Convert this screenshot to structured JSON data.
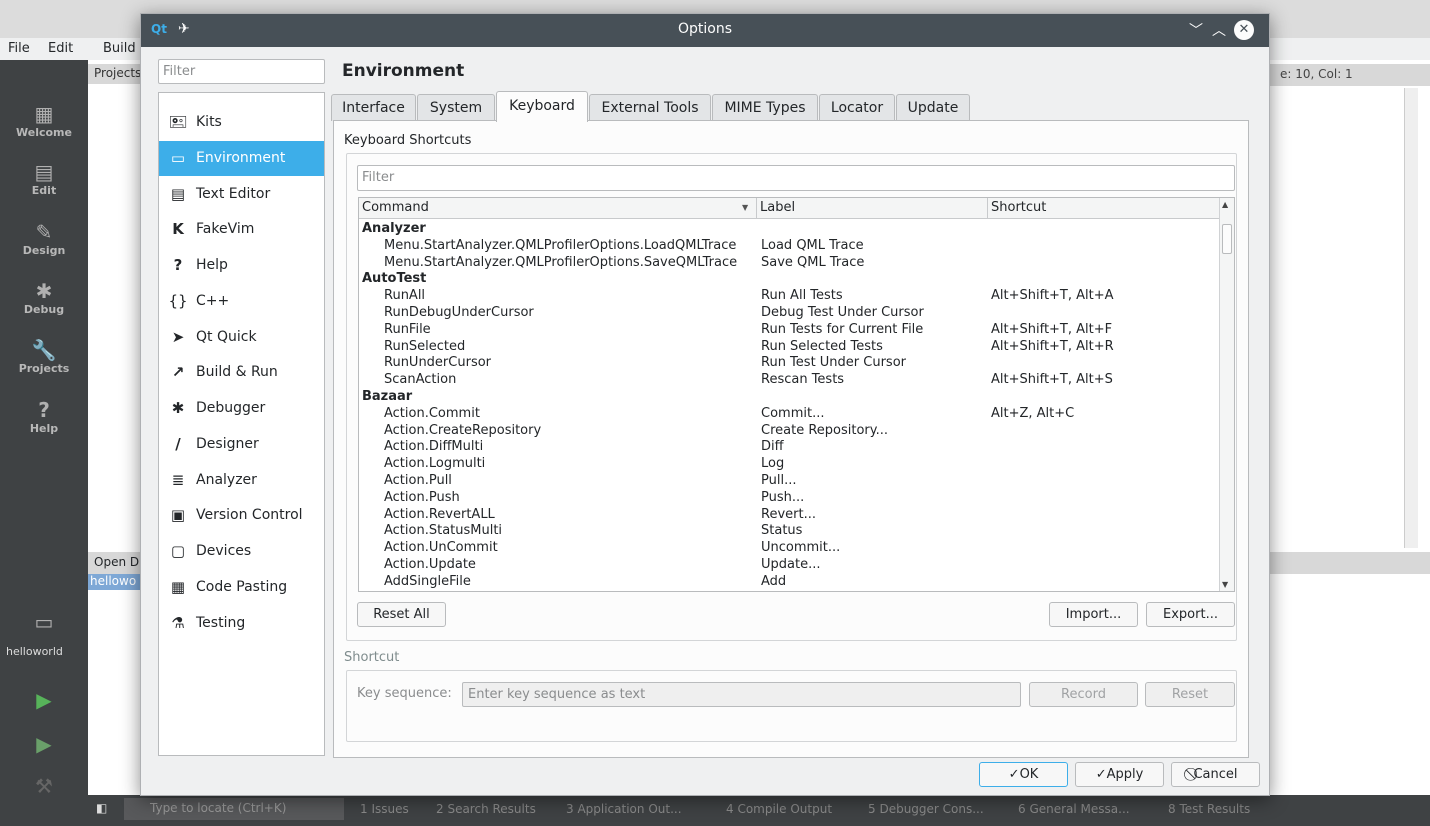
{
  "main_window": {
    "menu": [
      "File",
      "Edit",
      "Build"
    ],
    "modes": [
      {
        "label": "Welcome",
        "icon": "grid-icon"
      },
      {
        "label": "Edit",
        "icon": "document-icon"
      },
      {
        "label": "Design",
        "icon": "pen-icon"
      },
      {
        "label": "Debug",
        "icon": "bug-icon"
      },
      {
        "label": "Projects",
        "icon": "wrench-icon"
      },
      {
        "label": "Help",
        "icon": "help-icon"
      }
    ],
    "projects_label": "Projects",
    "open_documents_label": "Open D",
    "open_doc_selected": "hellowo",
    "position_info": "e: 10, Col: 1",
    "kit_label": "helloworld",
    "locator_placeholder": "Type to locate (Ctrl+K)",
    "output_tabs": [
      "1 Issues",
      "2 Search Results",
      "3 Application Out...",
      "4 Compile Output",
      "5 Debugger Cons...",
      "6 General Messa...",
      "8 Test Results"
    ]
  },
  "dialog": {
    "title": "Options",
    "filter_placeholder": "Filter",
    "categories": [
      {
        "label": "Kits",
        "icon": "kits-icon",
        "glyph": "🖭"
      },
      {
        "label": "Environment",
        "icon": "monitor-icon",
        "glyph": "▭"
      },
      {
        "label": "Text Editor",
        "icon": "text-editor-icon",
        "glyph": "▤"
      },
      {
        "label": "FakeVim",
        "icon": "fakevim-icon",
        "glyph": "K"
      },
      {
        "label": "Help",
        "icon": "help-icon",
        "glyph": "?"
      },
      {
        "label": "C++",
        "icon": "braces-icon",
        "glyph": "{}"
      },
      {
        "label": "Qt Quick",
        "icon": "qtquick-icon",
        "glyph": "➤"
      },
      {
        "label": "Build & Run",
        "icon": "hammer-icon",
        "glyph": "↗"
      },
      {
        "label": "Debugger",
        "icon": "bug-icon",
        "glyph": "✱"
      },
      {
        "label": "Designer",
        "icon": "pen-icon",
        "glyph": "/"
      },
      {
        "label": "Analyzer",
        "icon": "analyzer-icon",
        "glyph": "≣"
      },
      {
        "label": "Version Control",
        "icon": "version-control-icon",
        "glyph": "▣"
      },
      {
        "label": "Devices",
        "icon": "devices-icon",
        "glyph": "▢"
      },
      {
        "label": "Code Pasting",
        "icon": "clipboard-icon",
        "glyph": "▦"
      },
      {
        "label": "Testing",
        "icon": "flask-icon",
        "glyph": "⚗"
      }
    ],
    "selected_category": "Environment",
    "page_title": "Environment",
    "tabs": [
      "Interface",
      "System",
      "Keyboard",
      "External Tools",
      "MIME Types",
      "Locator",
      "Update"
    ],
    "active_tab": "Keyboard",
    "keyboard": {
      "group_label": "Keyboard Shortcuts",
      "filter_placeholder": "Filter",
      "columns": [
        "Command",
        "Label",
        "Shortcut"
      ],
      "rows": [
        {
          "group": true,
          "command": "Analyzer"
        },
        {
          "command": "Menu.StartAnalyzer.QMLProfilerOptions.LoadQMLTrace",
          "label": "Load QML Trace",
          "shortcut": ""
        },
        {
          "command": "Menu.StartAnalyzer.QMLProfilerOptions.SaveQMLTrace",
          "label": "Save QML Trace",
          "shortcut": ""
        },
        {
          "group": true,
          "command": "AutoTest"
        },
        {
          "command": "RunAll",
          "label": "Run All Tests",
          "shortcut": "Alt+Shift+T, Alt+A"
        },
        {
          "command": "RunDebugUnderCursor",
          "label": "Debug Test Under Cursor",
          "shortcut": ""
        },
        {
          "command": "RunFile",
          "label": "Run Tests for Current File",
          "shortcut": "Alt+Shift+T, Alt+F"
        },
        {
          "command": "RunSelected",
          "label": "Run Selected Tests",
          "shortcut": "Alt+Shift+T, Alt+R"
        },
        {
          "command": "RunUnderCursor",
          "label": "Run Test Under Cursor",
          "shortcut": ""
        },
        {
          "command": "ScanAction",
          "label": "Rescan Tests",
          "shortcut": "Alt+Shift+T, Alt+S"
        },
        {
          "group": true,
          "command": "Bazaar"
        },
        {
          "command": "Action.Commit",
          "label": "Commit...",
          "shortcut": "Alt+Z, Alt+C"
        },
        {
          "command": "Action.CreateRepository",
          "label": "Create Repository...",
          "shortcut": ""
        },
        {
          "command": "Action.DiffMulti",
          "label": "Diff",
          "shortcut": ""
        },
        {
          "command": "Action.Logmulti",
          "label": "Log",
          "shortcut": ""
        },
        {
          "command": "Action.Pull",
          "label": "Pull...",
          "shortcut": ""
        },
        {
          "command": "Action.Push",
          "label": "Push...",
          "shortcut": ""
        },
        {
          "command": "Action.RevertALL",
          "label": "Revert...",
          "shortcut": ""
        },
        {
          "command": "Action.StatusMulti",
          "label": "Status",
          "shortcut": ""
        },
        {
          "command": "Action.UnCommit",
          "label": "Uncommit...",
          "shortcut": ""
        },
        {
          "command": "Action.Update",
          "label": "Update...",
          "shortcut": ""
        },
        {
          "command": "AddSingleFile",
          "label": "Add",
          "shortcut": ""
        }
      ],
      "reset_all_label": "Reset All",
      "import_label": "Import...",
      "export_label": "Export..."
    },
    "shortcut": {
      "group_label": "Shortcut",
      "key_sequence_label": "Key sequence:",
      "key_placeholder": "Enter key sequence as text",
      "record_label": "Record",
      "reset_label": "Reset"
    },
    "buttons": {
      "ok": "✓OK",
      "apply": "✓Apply",
      "cancel": "⃠Cancel"
    }
  }
}
